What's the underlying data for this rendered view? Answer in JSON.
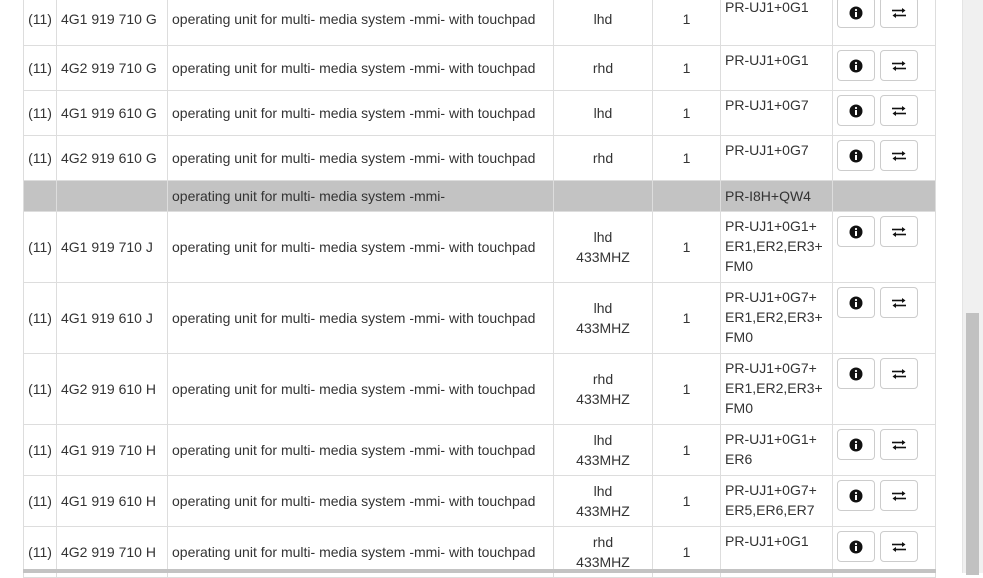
{
  "rows": [
    {
      "ref": "(11)",
      "part": "4G1 919 710 G",
      "desc": "operating unit for multi- media system -mmi- with touchpad",
      "side": "lhd",
      "side2": "",
      "qty": "1",
      "pr1": "PR-UJ1+0G1",
      "pr2": "",
      "pr3": "",
      "h": 53
    },
    {
      "ref": "(11)",
      "part": "4G2 919 710 G",
      "desc": "operating unit for multi- media system -mmi- with touchpad",
      "side": "rhd",
      "side2": "",
      "qty": "1",
      "pr1": "PR-UJ1+0G1",
      "pr2": "",
      "pr3": "",
      "h": 45
    },
    {
      "ref": "(11)",
      "part": "4G1 919 610 G",
      "desc": "operating unit for multi- media system -mmi- with touchpad",
      "side": "lhd",
      "side2": "",
      "qty": "1",
      "pr1": "PR-UJ1+0G7",
      "pr2": "",
      "pr3": "",
      "h": 45
    },
    {
      "ref": "(11)",
      "part": "4G2 919 610 G",
      "desc": "operating unit for multi- media system -mmi- with touchpad",
      "side": "rhd",
      "side2": "",
      "qty": "1",
      "pr1": "PR-UJ1+0G7",
      "pr2": "",
      "pr3": "",
      "h": 45
    },
    {
      "group": true,
      "desc": "operating unit for multi- media system -mmi-",
      "pr1": "PR-I8H+QW4",
      "h": 31
    },
    {
      "ref": "(11)",
      "part": "4G1 919 710 J",
      "desc": "operating unit for multi- media system -mmi- with touchpad",
      "side": "lhd",
      "side2": "433MHZ",
      "qty": "1",
      "pr1": "PR-UJ1+0G1+",
      "pr2": "ER1,ER2,ER3+",
      "pr3": "FM0",
      "h": 71
    },
    {
      "ref": "(11)",
      "part": "4G1 919 610 J",
      "desc": "operating unit for multi- media system -mmi- with touchpad",
      "side": "lhd",
      "side2": "433MHZ",
      "qty": "1",
      "pr1": "PR-UJ1+0G7+",
      "pr2": "ER1,ER2,ER3+",
      "pr3": "FM0",
      "h": 71
    },
    {
      "ref": "(11)",
      "part": "4G2 919 610 H",
      "desc": "operating unit for multi- media system -mmi- with touchpad",
      "side": "rhd",
      "side2": "433MHZ",
      "qty": "1",
      "pr1": "PR-UJ1+0G7+",
      "pr2": "ER1,ER2,ER3+",
      "pr3": "FM0",
      "h": 71
    },
    {
      "ref": "(11)",
      "part": "4G1 919 710 H",
      "desc": "operating unit for multi- media system -mmi- with touchpad",
      "side": "lhd",
      "side2": "433MHZ",
      "qty": "1",
      "pr1": "PR-UJ1+0G1+",
      "pr2": "ER6",
      "pr3": "",
      "h": 51
    },
    {
      "ref": "(11)",
      "part": "4G1 919 610 H",
      "desc": "operating unit for multi- media system -mmi- with touchpad",
      "side": "lhd",
      "side2": "433MHZ",
      "qty": "1",
      "pr1": "PR-UJ1+0G7+",
      "pr2": "ER5,ER6,ER7",
      "pr3": "",
      "h": 51
    },
    {
      "ref": "(11)",
      "part": "4G2 919 710 H",
      "desc": "operating unit for multi- media system -mmi- with touchpad",
      "side": "rhd",
      "side2": "433MHZ",
      "qty": "1",
      "pr1": "PR-UJ1+0G1",
      "pr2": "",
      "pr3": "",
      "h": 51
    }
  ],
  "icons": {
    "info": "info-circle-icon",
    "compare": "exchange-arrows-icon"
  },
  "colors": {
    "group_row_bg": "#c3c3c3",
    "border": "#dddddd",
    "text": "#333333",
    "button_border": "#cccccc"
  }
}
